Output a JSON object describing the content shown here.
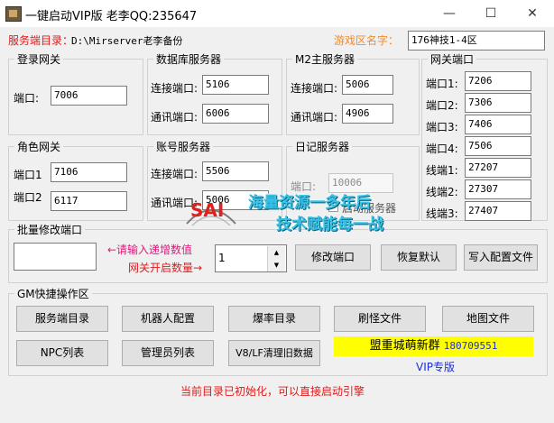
{
  "window": {
    "title": "一键启动VIP版 老李QQ:235647",
    "min_glyph": "—",
    "max_glyph": "☐",
    "close_glyph": "✕"
  },
  "top": {
    "server_dir_label": "服务端目录：",
    "server_dir_value": "D:\\Mirserver老李备份",
    "game_zone_label": "游戏区名字：",
    "game_zone_value": "176神技1-4区"
  },
  "login_gate": {
    "title": "登录网关",
    "port_label": "端口:",
    "port_value": "7006"
  },
  "db_server": {
    "title": "数据库服务器",
    "connect_label": "连接端口:",
    "connect_value": "5106",
    "comm_label": "通讯端口:",
    "comm_value": "6006"
  },
  "m2_server": {
    "title": "M2主服务器",
    "connect_label": "连接端口:",
    "connect_value": "5006",
    "comm_label": "通讯端口:",
    "comm_value": "4906"
  },
  "gateway_ports": {
    "title": "网关端口",
    "rows": [
      {
        "label": "端口1:",
        "value": "7206"
      },
      {
        "label": "端口2:",
        "value": "7306"
      },
      {
        "label": "端口3:",
        "value": "7406"
      },
      {
        "label": "端口4:",
        "value": "7506"
      },
      {
        "label": "线端1:",
        "value": "27207"
      },
      {
        "label": "线端2:",
        "value": "27307"
      },
      {
        "label": "线端3:",
        "value": "27407"
      }
    ]
  },
  "role_gate": {
    "title": "角色网关",
    "port1_label": "端口1",
    "port1_value": "7106",
    "port2_label": "端口2",
    "port2_value": "6117"
  },
  "account_server": {
    "title": "账号服务器",
    "connect_label": "连接端口:",
    "connect_value": "5506",
    "comm_label": "通讯端口:",
    "comm_value": "5006"
  },
  "log_server": {
    "title": "日记服务器",
    "port_label": "端口:",
    "port_value": "10006",
    "check_label": "启动服务器"
  },
  "batch": {
    "title": "批量修改端口",
    "hint_increment": "←请输入递增数值",
    "hint_count": "网关开启数量→",
    "spin_value": "1",
    "modify_button": "修改端口",
    "restore_button": "恢复默认",
    "write_button": "写入配置文件"
  },
  "gm": {
    "title": "GM快捷操作区",
    "buttons": {
      "server_dir": "服务端目录",
      "robot_config": "机器人配置",
      "drop_dir": "爆率目录",
      "monster_file": "刷怪文件",
      "map_file": "地图文件",
      "npc_list": "NPC列表",
      "admin_list": "管理员列表",
      "clear_old": "V8/LF清理旧数据"
    },
    "group_label": "盟重城萌新群",
    "group_number": "180709551",
    "vip_label": "VIP专版"
  },
  "status_text": "当前目录已初始化，可以直接启动引擎",
  "watermark": {
    "logo_text": "SAI",
    "line1": "海量资源一多年后",
    "line2": "技术赋能每一战"
  },
  "colors": {
    "red_text": "#e01a1a",
    "pink_text": "#e0187c",
    "blue_text": "#1a2fd0",
    "highlight_yellow": "#ffff00",
    "watermark_cyan": "#39c2e6"
  }
}
